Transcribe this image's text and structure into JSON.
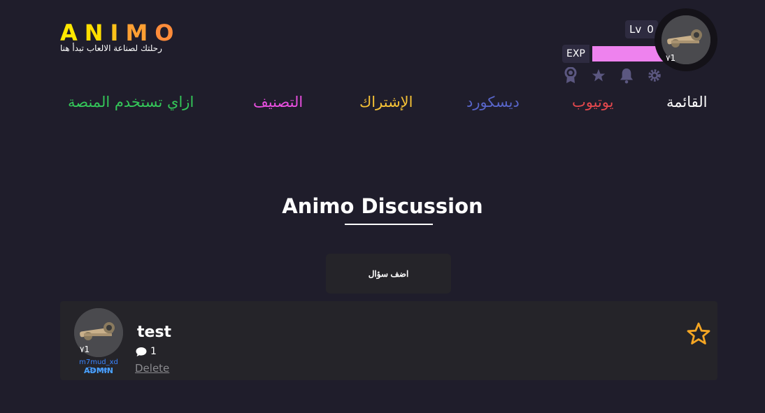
{
  "logo": {
    "letters": [
      "A",
      "N",
      "I",
      "M",
      "O"
    ],
    "letter_colors": [
      "#ffe800",
      "#ffde00",
      "#ffc21a",
      "#ffa033",
      "#ff8c3a"
    ],
    "subtitle": "رحلتك لصناعة الالعاب تبدأ هنا"
  },
  "profile": {
    "level_label": "Lv",
    "level_value": "0",
    "exp_label": "EXP",
    "avatar_number": "٧1",
    "icons": [
      "badge-icon",
      "star-icon",
      "bell-icon",
      "gear-icon"
    ]
  },
  "nav": {
    "items": [
      {
        "label": "القائمة",
        "color": "#ffffff"
      },
      {
        "label": "يوتيوب",
        "color": "#e5484d"
      },
      {
        "label": "ديسكورد",
        "color": "#5865c8"
      },
      {
        "label": "الإشتراك",
        "color": "#f6c236"
      },
      {
        "label": "التصنيف",
        "color": "#e94fe0"
      },
      {
        "label": "ازاي تستخدم المنصة",
        "color": "#34c759"
      }
    ]
  },
  "main": {
    "heading": "Animo Discussion",
    "add_button": "اضف سؤال"
  },
  "post": {
    "title": "test",
    "comment_count": "1",
    "avatar_number": "٧1",
    "username": "m7mud_xd Gamer",
    "role": "ADMIN",
    "delete_label": "Delete"
  },
  "colors": {
    "background": "#1f1d2b",
    "card": "#252429",
    "star": "#f5a623",
    "icon": "#5b5780",
    "exp_fill": "#ee82ee"
  }
}
